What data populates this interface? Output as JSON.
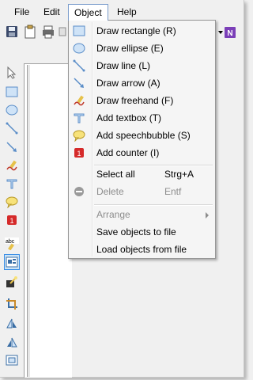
{
  "menubar": {
    "file": "File",
    "edit": "Edit",
    "object": "Object",
    "help": "Help"
  },
  "object_menu": {
    "draw_rectangle": "Draw rectangle (R)",
    "draw_ellipse": "Draw ellipse (E)",
    "draw_line": "Draw line (L)",
    "draw_arrow": "Draw arrow (A)",
    "draw_freehand": "Draw freehand (F)",
    "add_textbox": "Add textbox (T)",
    "add_speechbubble": "Add speechbubble (S)",
    "add_counter": "Add counter (I)",
    "select_all": "Select all",
    "select_all_shortcut": "Strg+A",
    "delete": "Delete",
    "delete_shortcut": "Entf",
    "arrange": "Arrange",
    "save_objects": "Save objects to file",
    "load_objects": "Load objects from file"
  },
  "toolbar": {
    "onenote_letter": "N"
  },
  "left_tools": {
    "spellcheck_label": "abc",
    "counter_label": "1"
  },
  "colors": {
    "menu_background": "#f5f5f5",
    "menu_border": "#979797",
    "accent_blue": "#3a8ee6",
    "disabled_text": "#8d8d8d",
    "onenote_purple": "#7b3fb8",
    "counter_red": "#d52a2a"
  }
}
